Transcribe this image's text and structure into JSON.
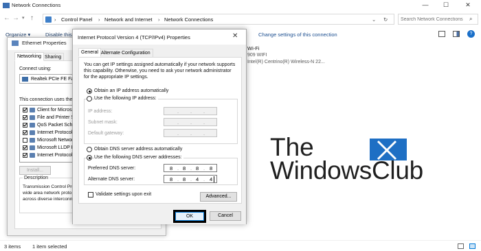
{
  "network_connections": {
    "title": "Network Connections",
    "address_path": [
      "Control Panel",
      "Network and Internet",
      "Network Connections"
    ],
    "search_placeholder": "Search Network Connections",
    "commands": [
      "Organize ▾",
      "Disable this...",
      "Change settings of this connection"
    ],
    "wifi": {
      "name": "Wi-Fi",
      "ssid": "909 WIFI",
      "adapter": "Intel(R) Centrino(R) Wireless-N 22..."
    },
    "status": {
      "items": "3 items",
      "selected": "1 item selected"
    }
  },
  "ethernet_properties": {
    "title": "Ethernet Properties",
    "tabs": [
      "Networking",
      "Sharing"
    ],
    "connect_using_label": "Connect using:",
    "adapter": "Realtek PCIe FE Fam",
    "items_label": "This connection uses the fo",
    "components": [
      {
        "name": "Client for Microsof",
        "checked": true
      },
      {
        "name": "File and Printer Sha",
        "checked": true
      },
      {
        "name": "QoS Packet Sche",
        "checked": true
      },
      {
        "name": "Internet Protocol V",
        "checked": true
      },
      {
        "name": "Microsoft Network",
        "checked": false
      },
      {
        "name": "Microsoft LLDP Pr",
        "checked": true
      },
      {
        "name": "Internet Protocol V",
        "checked": true
      }
    ],
    "install_label": "Install...",
    "description_label": "Description",
    "description_lines": [
      "Transmission Control Prot",
      "wide area network proto",
      "across diverse interconn"
    ]
  },
  "ipv4_dialog": {
    "title": "Internet Protocol Version 4 (TCP/IPv4) Properties",
    "close": "✕",
    "tabs": [
      "General",
      "Alternate Configuration"
    ],
    "intro_lines": [
      "You can get IP settings assigned automatically if your network supports",
      "this capability. Otherwise, you need to ask your network administrator",
      "for the appropriate IP settings."
    ],
    "obtain_ip_auto": "Obtain an IP address automatically",
    "use_following_ip": "Use the following IP address:",
    "ip_address_label": "IP address:",
    "subnet_mask_label": "Subnet mask:",
    "default_gateway_label": "Default gateway:",
    "obtain_dns_auto": "Obtain DNS server address automatically",
    "use_following_dns": "Use the following DNS server addresses:",
    "preferred_dns_label": "Preferred DNS server:",
    "preferred_dns_octets": [
      "8",
      "8",
      "8",
      "8"
    ],
    "alternate_dns_label": "Alternate DNS server:",
    "alternate_dns_octets": [
      "8",
      "8",
      "4",
      "4"
    ],
    "validate_label": "Validate settings upon exit",
    "advanced_label": "Advanced...",
    "ok_label": "OK",
    "cancel_label": "Cancel"
  },
  "watermark": {
    "line1": "The",
    "line2": "WindowsClub"
  },
  "colors": {
    "link": "#1a4d8f",
    "logo_blue": "#1e6fc4",
    "focus": "#0078d7"
  }
}
